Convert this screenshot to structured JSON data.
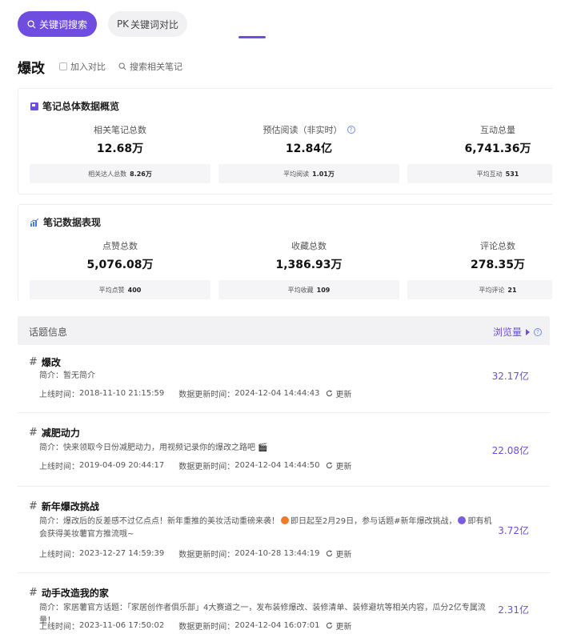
{
  "tabs": {
    "keyword_search": "关键词搜索",
    "pk_prefix": "PK",
    "keyword_compare": "关键词对比"
  },
  "keyword": {
    "title": "爆改",
    "add_compare": "加入对比",
    "search_notes": "搜索相关笔记"
  },
  "overview": {
    "title": "笔记总体数据概览",
    "metrics": [
      {
        "label": "相关笔记总数",
        "value": "12.68万",
        "sub_label": "相关达人总数",
        "sub_value": "8.26万"
      },
      {
        "label": "预估阅读（非实时）",
        "value": "12.84亿",
        "sub_label": "平均阅读",
        "sub_value": "1.01万"
      },
      {
        "label": "互动总量",
        "value": "6,741.36万",
        "sub_label": "平均互动",
        "sub_value": "531"
      }
    ]
  },
  "performance": {
    "title": "笔记数据表现",
    "metrics": [
      {
        "label": "点赞总数",
        "value": "5,076.08万",
        "sub_label": "平均点赞",
        "sub_value": "400"
      },
      {
        "label": "收藏总数",
        "value": "1,386.93万",
        "sub_label": "平均收藏",
        "sub_value": "109"
      },
      {
        "label": "评论总数",
        "value": "278.35万",
        "sub_label": "平均评论",
        "sub_value": "21"
      }
    ]
  },
  "topics": {
    "title": "话题信息",
    "sort_label": "浏览量",
    "online_label": "上线时间：",
    "updated_label": "数据更新时间：",
    "refresh_label": "更新",
    "desc_label": "简介：",
    "items": [
      {
        "name": "爆改",
        "desc": "暂无简介",
        "online": "2018-11-10 21:15:59",
        "updated": "2024-12-04 14:44:43",
        "views": "32.17亿"
      },
      {
        "name": "减肥动力",
        "desc": "快来领取今日份减肥动力，用视频记录你的爆改之路吧 🎬",
        "online": "2019-04-09 20:44:17",
        "updated": "2024-12-04 14:44:50",
        "views": "22.08亿"
      },
      {
        "name": "新年爆改挑战",
        "desc_a": "爆改后的反差感不过亿点点！新年重推的美妆活动重磅来袭！",
        "desc_b": "即日起至2月29日，参与话题#新年爆改挑战，",
        "desc_c": "即有机会获得美妆薯官方推流哦~",
        "online": "2023-12-27 14:59:39",
        "updated": "2024-10-28 13:44:19",
        "views": "3.72亿"
      },
      {
        "name": "动手改造我的家",
        "desc": "家居薯官方话题：「家居创作者俱乐部」4大赛道之一，发布装修爆改、装修清单、装修避坑等相关内容，瓜分2亿专属流量！",
        "online": "2023-11-06 17:50:02",
        "updated": "2024-12-04 16:07:01",
        "views": "2.31亿"
      }
    ]
  },
  "colors": {
    "accent": "#6e4de0",
    "tab_inactive_bg": "#f1f1f3",
    "sub_bg": "#f5f5f7",
    "help_blue": "#6e8df0"
  }
}
